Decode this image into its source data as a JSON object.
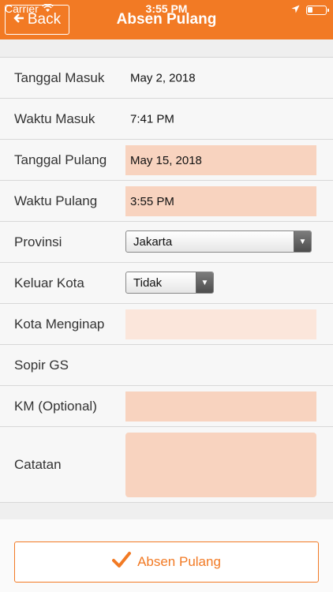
{
  "status_bar": {
    "carrier": "Carrier",
    "time": "3:55 PM"
  },
  "header": {
    "back_label": "Back",
    "title": "Absen Pulang"
  },
  "form": {
    "tanggal_masuk": {
      "label": "Tanggal Masuk",
      "value": "May 2, 2018"
    },
    "waktu_masuk": {
      "label": "Waktu Masuk",
      "value": "7:41 PM"
    },
    "tanggal_pulang": {
      "label": "Tanggal Pulang",
      "value": "May 15, 2018"
    },
    "waktu_pulang": {
      "label": "Waktu Pulang",
      "value": "3:55 PM"
    },
    "provinsi": {
      "label": "Provinsi",
      "value": "Jakarta"
    },
    "keluar_kota": {
      "label": "Keluar Kota",
      "value": "Tidak"
    },
    "kota_menginap": {
      "label": "Kota Menginap",
      "value": ""
    },
    "sopir_gs": {
      "label": "Sopir GS"
    },
    "km": {
      "label": "KM (Optional)",
      "value": ""
    },
    "catatan": {
      "label": "Catatan",
      "value": ""
    }
  },
  "submit_label": "Absen Pulang",
  "colors": {
    "accent": "#f27a24",
    "field_fill": "#f8d3bf",
    "field_fill_light": "#fbe6db"
  }
}
